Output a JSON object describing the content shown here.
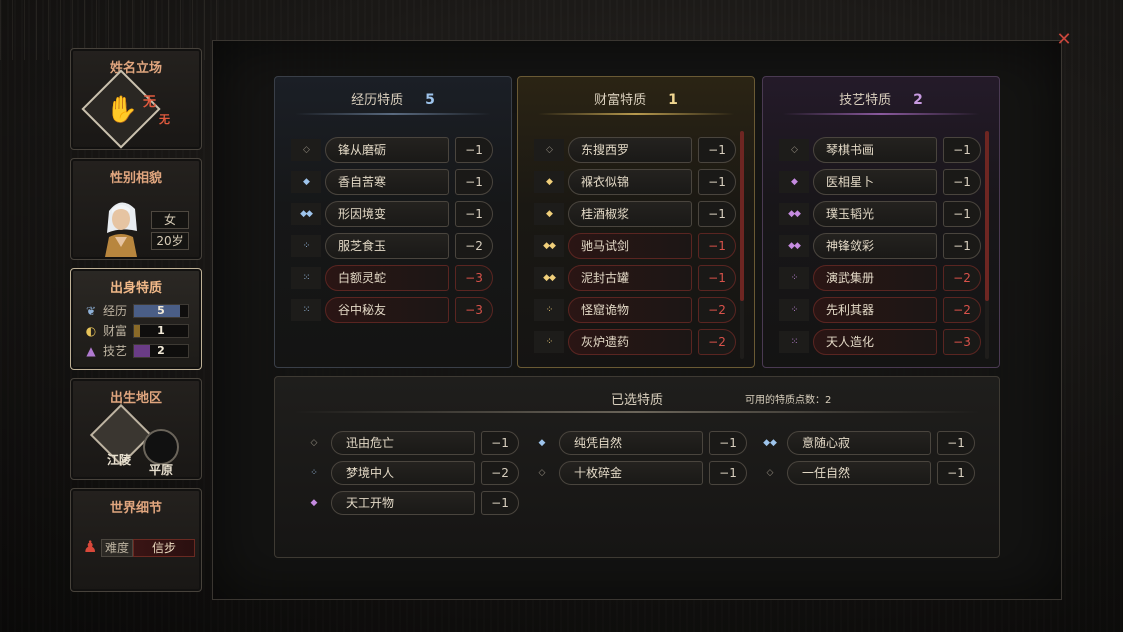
{
  "sidebar": {
    "stance": {
      "title": "姓名立场",
      "value_main": "无",
      "value_sub": "无"
    },
    "gender": {
      "title": "性别相貌",
      "sex": "女",
      "age": "20岁"
    },
    "origin": {
      "title": "出身特质",
      "rows": [
        {
          "label": "经历",
          "value": "5",
          "fill": 0.85,
          "color": "#4a5e86",
          "icon": "feather-icon",
          "glyph": "❦"
        },
        {
          "label": "财富",
          "value": "1",
          "fill": 0.12,
          "color": "#8a6a28",
          "icon": "gold-ingot-icon",
          "glyph": "◐"
        },
        {
          "label": "技艺",
          "value": "2",
          "fill": 0.3,
          "color": "#6a3c86",
          "icon": "triangle-gem-icon",
          "glyph": "▲"
        }
      ]
    },
    "region": {
      "title": "出生地区",
      "place": "江陵",
      "terrain": "平原"
    },
    "world": {
      "title": "世界细节",
      "difficulty_label": "难度",
      "difficulty_value": "信步"
    }
  },
  "panels": {
    "experience": {
      "title": "经历特质",
      "count": "5",
      "items": [
        {
          "name": "锋从磨砺",
          "cost": "−1",
          "dots": "◇",
          "tier": "plain",
          "neg": false
        },
        {
          "name": "香自苦寒",
          "cost": "−1",
          "dots": "◆",
          "tier": "exp",
          "neg": false
        },
        {
          "name": "形因境变",
          "cost": "−1",
          "dots": "◆◆",
          "tier": "exp",
          "neg": false
        },
        {
          "name": "服芝食玉",
          "cost": "−2",
          "dots": "⁘",
          "tier": "exp",
          "neg": false
        },
        {
          "name": "白额灵蛇",
          "cost": "−3",
          "dots": "⁙",
          "tier": "exp",
          "neg": true
        },
        {
          "name": "谷中秘友",
          "cost": "−3",
          "dots": "⁙",
          "tier": "exp",
          "neg": true
        }
      ]
    },
    "wealth": {
      "title": "财富特质",
      "count": "1",
      "items": [
        {
          "name": "东搜西罗",
          "cost": "−1",
          "dots": "◇",
          "tier": "plain",
          "neg": false
        },
        {
          "name": "褓衣似锦",
          "cost": "−1",
          "dots": "◆",
          "tier": "wealth",
          "neg": false
        },
        {
          "name": "桂酒椒浆",
          "cost": "−1",
          "dots": "◆",
          "tier": "wealth",
          "neg": false
        },
        {
          "name": "驰马试剑",
          "cost": "−1",
          "dots": "◆◆",
          "tier": "wealth",
          "neg": true
        },
        {
          "name": "泥封古罐",
          "cost": "−1",
          "dots": "◆◆",
          "tier": "wealth",
          "neg": true
        },
        {
          "name": "怪窟诡物",
          "cost": "−2",
          "dots": "⁘",
          "tier": "wealth",
          "neg": true
        },
        {
          "name": "灰炉遗药",
          "cost": "−2",
          "dots": "⁘",
          "tier": "wealth",
          "neg": true
        }
      ]
    },
    "skill": {
      "title": "技艺特质",
      "count": "2",
      "items": [
        {
          "name": "琴棋书画",
          "cost": "−1",
          "dots": "◇",
          "tier": "plain",
          "neg": false
        },
        {
          "name": "医相星卜",
          "cost": "−1",
          "dots": "◆",
          "tier": "skill",
          "neg": false
        },
        {
          "name": "璞玉韬光",
          "cost": "−1",
          "dots": "◆◆",
          "tier": "skill",
          "neg": false
        },
        {
          "name": "神锋敛彩",
          "cost": "−1",
          "dots": "◆◆",
          "tier": "skill",
          "neg": false
        },
        {
          "name": "演武集册",
          "cost": "−2",
          "dots": "⁘",
          "tier": "skill",
          "neg": true
        },
        {
          "name": "先利其器",
          "cost": "−2",
          "dots": "⁘",
          "tier": "skill",
          "neg": true
        },
        {
          "name": "天人造化",
          "cost": "−3",
          "dots": "⁙",
          "tier": "skill",
          "neg": true
        }
      ]
    }
  },
  "selected": {
    "title": "已选特质",
    "points_text": "可用的特质点数：2",
    "items": [
      {
        "name": "迅由危亡",
        "cost": "−1",
        "dots": "◇",
        "tier": "plain"
      },
      {
        "name": "纯凭自然",
        "cost": "−1",
        "dots": "◆",
        "tier": "exp"
      },
      {
        "name": "意随心寂",
        "cost": "−1",
        "dots": "◆◆",
        "tier": "exp"
      },
      {
        "name": "梦境中人",
        "cost": "−2",
        "dots": "⁘",
        "tier": "exp"
      },
      {
        "name": "十枚碎金",
        "cost": "−1",
        "dots": "◇",
        "tier": "plain"
      },
      {
        "name": "一任自然",
        "cost": "−1",
        "dots": "◇",
        "tier": "plain"
      },
      {
        "name": "天工开物",
        "cost": "−1",
        "dots": "◆",
        "tier": "skill"
      }
    ]
  },
  "close_label": "✕"
}
